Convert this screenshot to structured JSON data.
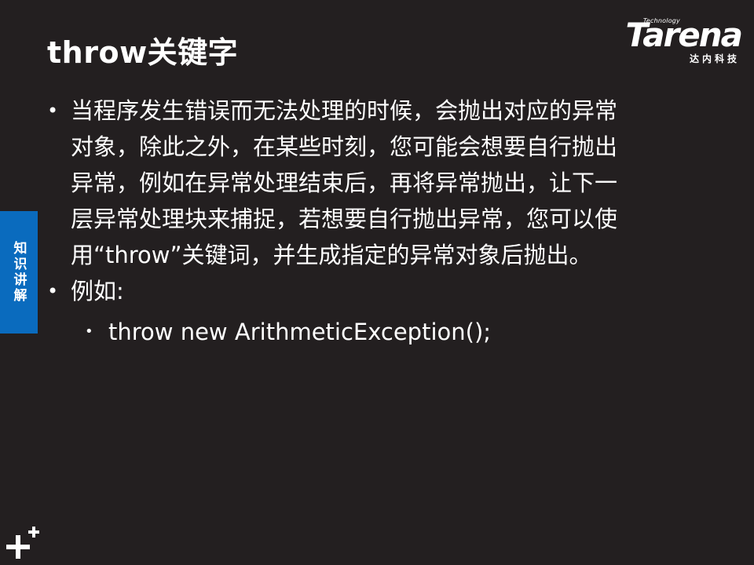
{
  "slide": {
    "title": "throw关键字",
    "logo": {
      "tech": "Technology",
      "word": "Tarena",
      "cn": "达内科技"
    },
    "side_tab": "知识讲解",
    "bullets": [
      {
        "lines": [
          "当程序发生错误而无法处理的时候，会抛出对应的异常",
          "对象，除此之外，在某些时刻，您可能会想要自行抛出",
          "异常，例如在异常处理结束后，再将异常抛出，让下一",
          "层异常处理块来捕捉，若想要自行抛出异常，您可以使",
          "用“throw”关键词，并生成指定的异常对象后抛出。"
        ]
      },
      {
        "lines": [
          "例如:"
        ]
      }
    ],
    "sub_bullet": "throw new ArithmeticException();",
    "bullet_glyph": "•"
  }
}
